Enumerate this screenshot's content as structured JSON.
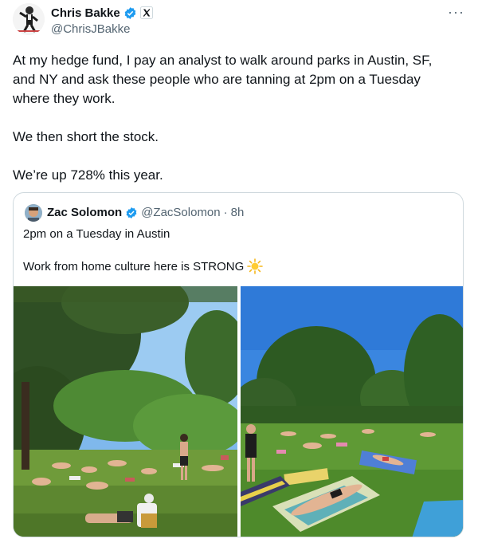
{
  "tweet": {
    "author_name": "Chris Bakke",
    "author_handle": "@ChrisJBakke",
    "more_icon": "more-icon",
    "body": [
      "At my hedge fund, I pay an analyst to walk around parks in Austin, SF,",
      "and NY and ask these people who are tanning at 2pm on a Tuesday",
      "where they work.",
      "We then short the stock.",
      "We’re up 728% this year."
    ]
  },
  "quote": {
    "author_name": "Zac Solomon",
    "author_handle": "@ZacSolomon",
    "separator": "·",
    "time": "8h",
    "line1": "2pm on a Tuesday in Austin",
    "line2": "Work from home culture here is STRONG",
    "emoji": "sun-emoji"
  },
  "colors": {
    "verified": "#1d9bf0",
    "muted_text": "#536471",
    "border": "#cfd9de"
  }
}
